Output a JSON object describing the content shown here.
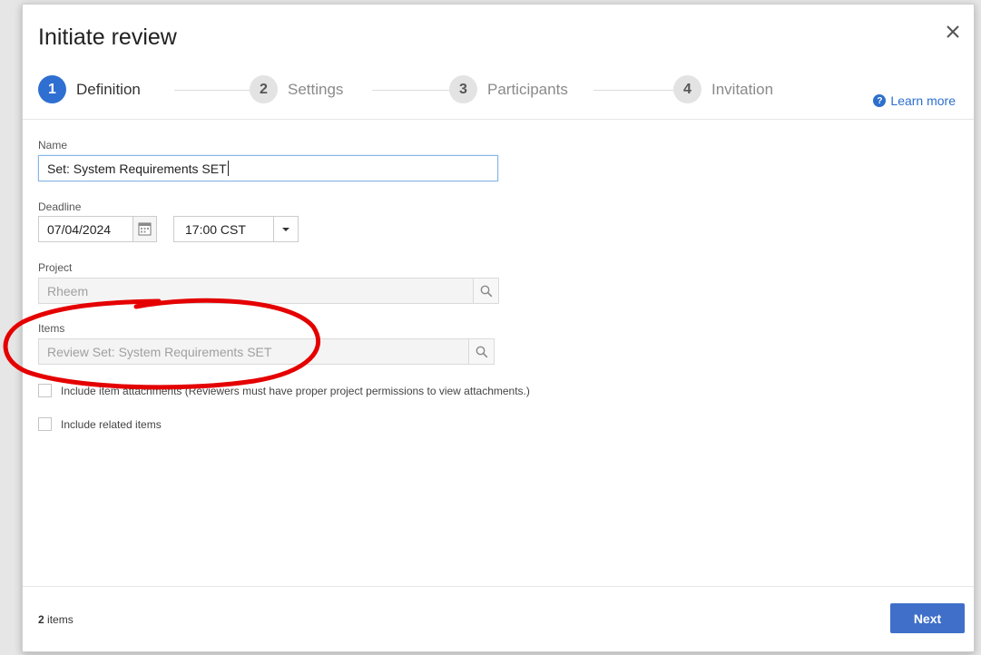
{
  "dialog": {
    "title": "Initiate review",
    "learn_more": "Learn more"
  },
  "steps": [
    {
      "number": "1",
      "label": "Definition",
      "active": true
    },
    {
      "number": "2",
      "label": "Settings",
      "active": false
    },
    {
      "number": "3",
      "label": "Participants",
      "active": false
    },
    {
      "number": "4",
      "label": "Invitation",
      "active": false
    }
  ],
  "form": {
    "name_label": "Name",
    "name_value": "Set: System Requirements SET",
    "deadline_label": "Deadline",
    "deadline_date": "07/04/2024",
    "deadline_time": "17:00 CST",
    "project_label": "Project",
    "project_value": "Rheem",
    "items_label": "Items",
    "items_value": "Review Set: System Requirements SET",
    "include_attachments": "Include item attachments (Reviewers must have proper project permissions to view attachments.)",
    "include_related": "Include related items"
  },
  "footer": {
    "count": "2",
    "count_suffix": " items",
    "next_label": "Next"
  },
  "colors": {
    "accent": "#2e6fd1",
    "button": "#3f6fc9",
    "annotation": "#e50000"
  }
}
